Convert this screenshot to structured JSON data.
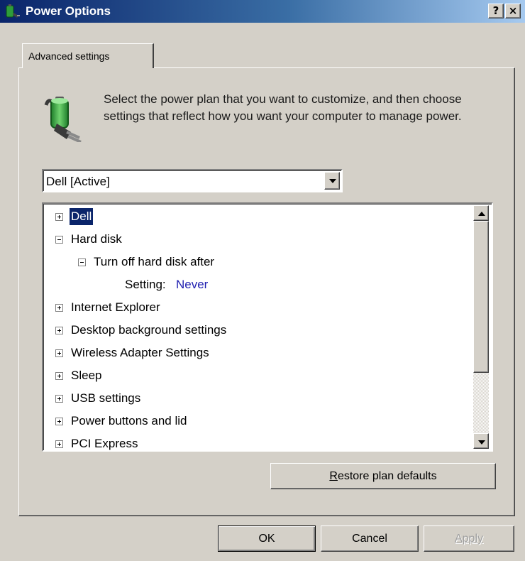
{
  "window": {
    "title": "Power Options",
    "help_button": "?",
    "close_button": "×"
  },
  "tabs": [
    {
      "label": "Advanced settings",
      "active": true
    }
  ],
  "intro_text": "Select the power plan that you want to customize, and then choose settings that reflect how you want your computer to manage power.",
  "plan_dropdown": {
    "selected": "Dell [Active]"
  },
  "tree": {
    "items": [
      {
        "label": "Dell",
        "state": "collapsed",
        "level": 0,
        "selected": true
      },
      {
        "label": "Hard disk",
        "state": "expanded",
        "level": 0
      },
      {
        "label": "Turn off hard disk after",
        "state": "expanded",
        "level": 1
      },
      {
        "label": "Setting:",
        "value": "Never",
        "level": 2
      },
      {
        "label": "Internet Explorer",
        "state": "collapsed",
        "level": 0
      },
      {
        "label": "Desktop background settings",
        "state": "collapsed",
        "level": 0
      },
      {
        "label": "Wireless Adapter Settings",
        "state": "collapsed",
        "level": 0
      },
      {
        "label": "Sleep",
        "state": "collapsed",
        "level": 0
      },
      {
        "label": "USB settings",
        "state": "collapsed",
        "level": 0
      },
      {
        "label": "Power buttons and lid",
        "state": "collapsed",
        "level": 0
      },
      {
        "label": "PCI Express",
        "state": "collapsed",
        "level": 0
      }
    ]
  },
  "buttons": {
    "restore": {
      "first": "R",
      "rest": "estore plan defaults"
    },
    "ok": "OK",
    "cancel": "Cancel",
    "apply": "Apply"
  },
  "colors": {
    "titlebar_start": "#0a246a",
    "titlebar_end": "#a6caf0",
    "selection": "#0a246a",
    "setting_value": "#1f1fb0",
    "face": "#d4d0c8"
  },
  "icons": [
    "power-options-icon",
    "battery-plug-icon",
    "help-icon",
    "close-icon",
    "dropdown-arrow-icon",
    "scroll-up-icon",
    "scroll-down-icon",
    "expand-icon",
    "collapse-icon"
  ]
}
